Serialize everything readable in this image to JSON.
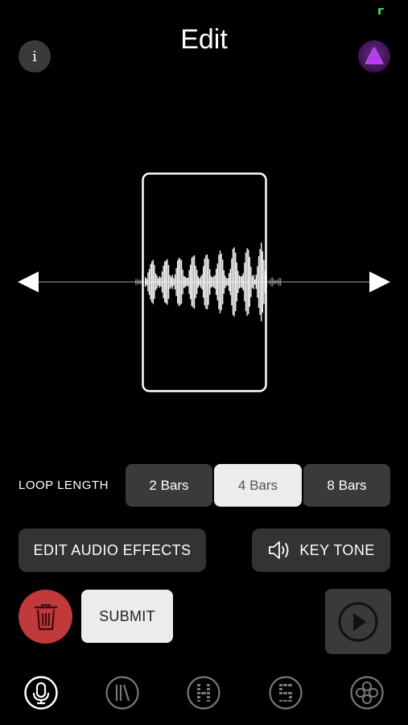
{
  "header": {
    "title": "Edit",
    "info_label": "i"
  },
  "loop": {
    "label": "LOOP LENGTH",
    "options": [
      "2 Bars",
      "4 Bars",
      "8 Bars"
    ],
    "selected": "4 Bars"
  },
  "actions": {
    "edit_effects_label": "EDIT AUDIO EFFECTS",
    "key_tone_label": "KEY TONE",
    "submit_label": "SUBMIT"
  },
  "colors": {
    "background": "#000000",
    "button_dark": "#3a3a3a",
    "selected": "#ececec",
    "trash_red": "#c0393b",
    "avatar_purple": "#9b30d6",
    "status_green": "#3bd15a"
  },
  "icons": {
    "info": "info-icon",
    "avatar": "triangle-avatar-icon",
    "left": "arrow-left-icon",
    "right": "arrow-right-icon",
    "speaker": "speaker-icon",
    "trash": "trash-icon",
    "play": "play-icon",
    "nav": [
      "microphone-icon",
      "library-icon",
      "h-icon",
      "s-icon",
      "circles-icon"
    ]
  }
}
